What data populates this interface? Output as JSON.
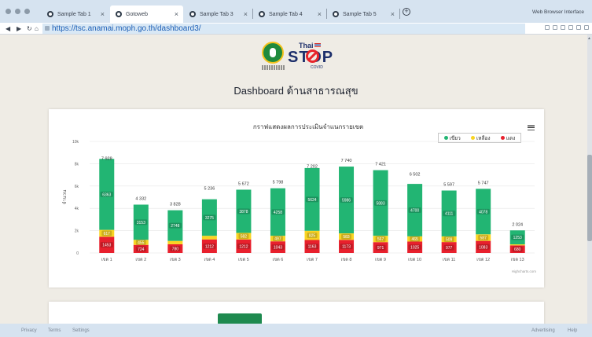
{
  "browser": {
    "tabs": [
      {
        "label": "Sample Tab 1",
        "active": false
      },
      {
        "label": "Gotoweb",
        "active": true
      },
      {
        "label": "Sample Tab 3",
        "active": false
      },
      {
        "label": "Sample Tab 4",
        "active": false
      },
      {
        "label": "Sample Tab 5",
        "active": false
      }
    ],
    "window_label": "Web Browser Interface",
    "url": "https://tsc.anamai.moph.go.th/dashboard3/"
  },
  "page": {
    "logo": {
      "thai_text": "Thai",
      "stop_text": "STOP",
      "covid_text": "COVID"
    },
    "title": "Dashboard ด้านสาธารณสุข",
    "colors": {
      "green": "#22b573",
      "yellow": "#f9d423",
      "red": "#e8202d"
    }
  },
  "chart_data": {
    "type": "bar",
    "stacked": true,
    "title": "กราฟแสดงผลการประเมินจำแนกรายเขต",
    "ylabel": "จำนวน",
    "xlabel": "",
    "ylim": [
      0,
      10000
    ],
    "y_ticks": [
      "0",
      "2k",
      "4k",
      "6k",
      "8k",
      "10k"
    ],
    "categories": [
      "เขต 1",
      "เขต 2",
      "เขต 3",
      "เขต 4",
      "เขต 5",
      "เขต 6",
      "เขต 7",
      "เขต 8",
      "เขต 9",
      "เขต 10",
      "เขต 11",
      "เขต 12",
      "เขต 13"
    ],
    "totals": [
      "7 928",
      "4 332",
      "3 828",
      "5 236",
      "5 672",
      "5 798",
      "7 202",
      "7 740",
      "7 421",
      "6 502",
      "5 597",
      "5 747",
      "2 024"
    ],
    "total_values": [
      7928,
      4332,
      3828,
      5236,
      5672,
      5798,
      7202,
      7740,
      7421,
      6502,
      5597,
      5747,
      2024
    ],
    "series": [
      {
        "name": "เขียว",
        "color": "#22b573",
        "values": [
          6363,
          3153,
          2748,
          3275,
          3878,
          4258,
          5624,
          5986,
          5883,
          4700,
          4111,
          4078,
          1253
        ]
      },
      {
        "name": "เหลือง",
        "color": "#f9d423",
        "values": [
          617,
          455,
          300,
          327,
          582,
          497,
          825,
          583,
          567,
          465,
          509,
          587,
          91
        ]
      },
      {
        "name": "แดง",
        "color": "#e8202d",
        "values": [
          1453,
          724,
          780,
          1212,
          1212,
          1043,
          1163,
          1173,
          971,
          1025,
          977,
          1083,
          680
        ]
      }
    ],
    "bar_labels": [
      {
        "green": "6363",
        "yellow": "617",
        "red": "1453"
      },
      {
        "green": "3153",
        "yellow": "455",
        "red": "724"
      },
      {
        "green": "2748",
        "yellow": "",
        "red": "780"
      },
      {
        "green": "3275",
        "yellow": "",
        "red": "1212"
      },
      {
        "green": "3878",
        "yellow": "582",
        "red": "1212"
      },
      {
        "green": "4258",
        "yellow": "497",
        "red": "1043"
      },
      {
        "green": "5624",
        "yellow": "825",
        "red": "1163"
      },
      {
        "green": "5986",
        "yellow": "583",
        "red": "1173"
      },
      {
        "green": "5883",
        "yellow": "567",
        "red": "971"
      },
      {
        "green": "4700",
        "yellow": "465",
        "red": "1025"
      },
      {
        "green": "4111",
        "yellow": "509",
        "red": "977"
      },
      {
        "green": "4078",
        "yellow": "587",
        "red": "1083"
      },
      {
        "green": "1253",
        "yellow": "",
        "red": "680"
      }
    ],
    "legend_position": "top-right",
    "grid": true,
    "credit": "Highcharts.com"
  },
  "footer": {
    "left": [
      "Privacy",
      "Terms",
      "Settings"
    ],
    "right": [
      "Advertising",
      "Help"
    ]
  }
}
